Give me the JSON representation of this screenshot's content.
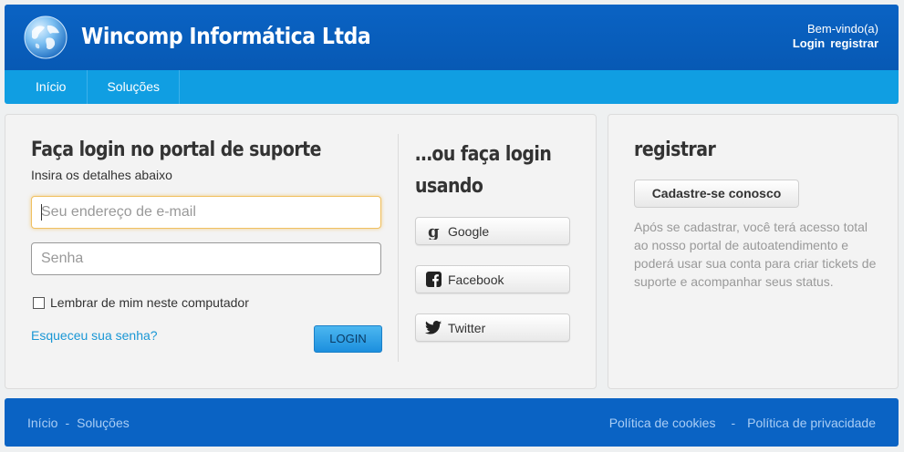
{
  "header": {
    "brand": "Wincomp Informática Ltda",
    "welcome": "Bem-vindo(a)",
    "login_link": "Login",
    "register_link": "registrar"
  },
  "nav": {
    "items": [
      {
        "label": "Início"
      },
      {
        "label": "Soluções"
      }
    ]
  },
  "login": {
    "title": "Faça login no portal de suporte",
    "subtitle": "Insira os detalhes abaixo",
    "email_placeholder": "Seu endereço de e-mail",
    "password_placeholder": "Senha",
    "remember_label": "Lembrar de mim neste computador",
    "remember_checked": false,
    "forgot_link": "Esqueceu sua senha?",
    "button_label": "LOGIN"
  },
  "social": {
    "title_line1": "…ou faça login",
    "title_line2": "usando",
    "buttons": [
      {
        "label": "Google",
        "icon": "google-icon"
      },
      {
        "label": "Facebook",
        "icon": "facebook-icon"
      },
      {
        "label": "Twitter",
        "icon": "twitter-icon"
      }
    ]
  },
  "register": {
    "title": "registrar",
    "button_label": "Cadastre-se conosco",
    "description": "Após se cadastrar, você terá acesso total ao nosso portal de autoatendimento e poderá usar sua conta para criar tickets de suporte e acompanhar seus status."
  },
  "footer": {
    "left_links": [
      "Início",
      "Soluções"
    ],
    "right_links": [
      "Política de cookies",
      "Política de privacidade"
    ],
    "separator": "-"
  },
  "colors": {
    "header_blue": "#0a63c4",
    "nav_blue": "#109ee2",
    "link_blue": "#1a97d5"
  }
}
